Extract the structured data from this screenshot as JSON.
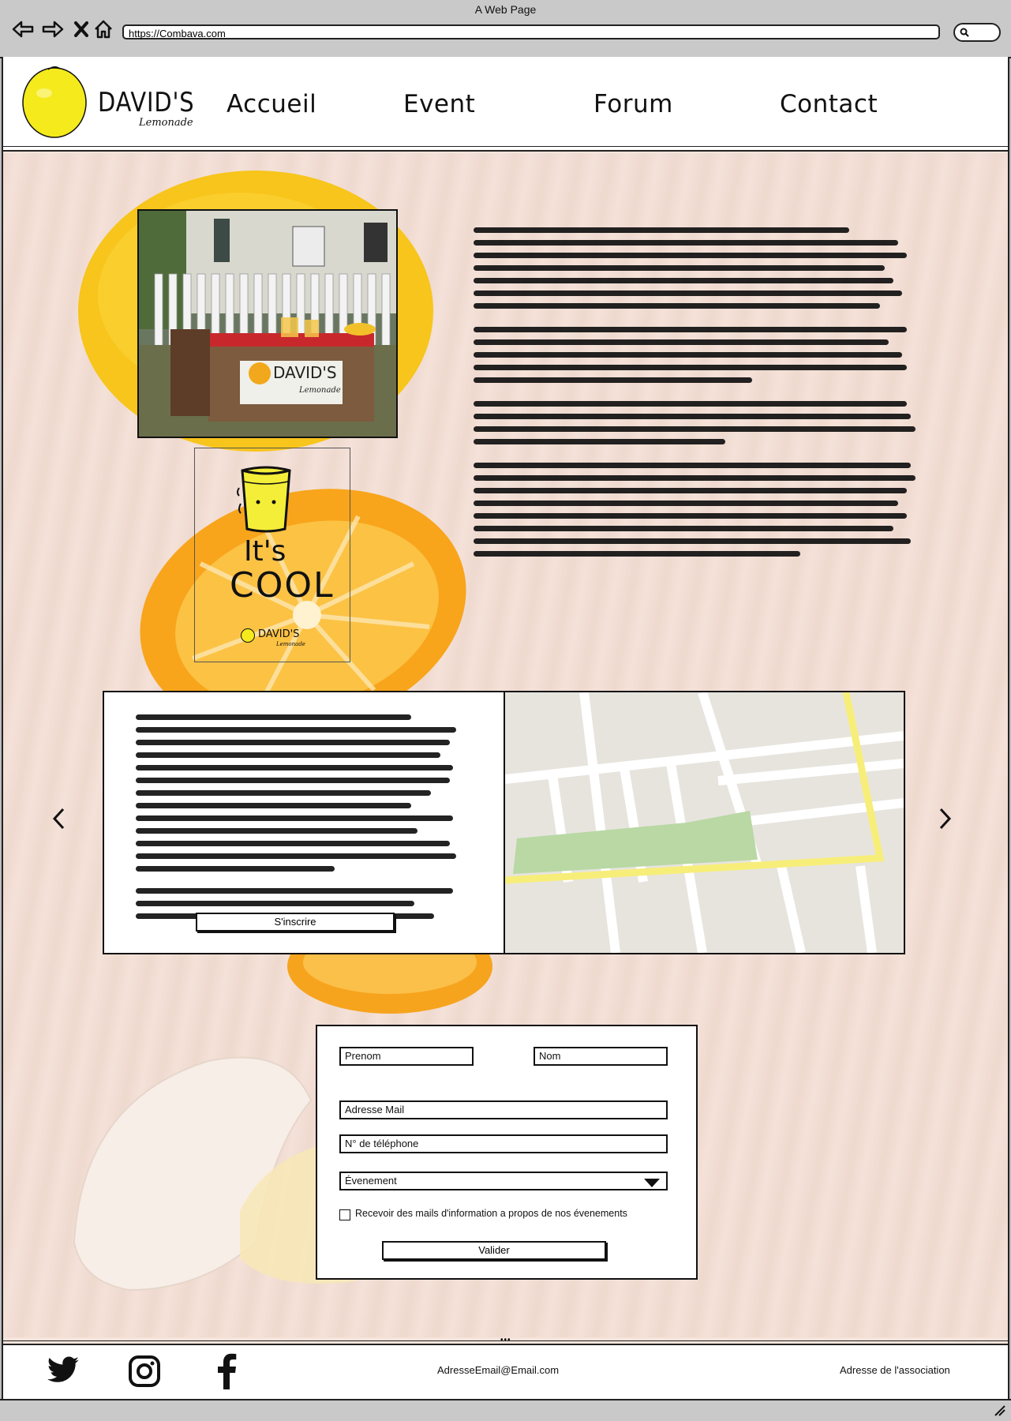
{
  "window": {
    "title": "A Web Page"
  },
  "browser": {
    "url": "https://Combava.com"
  },
  "brand": {
    "name_main": "DAVID'S",
    "name_sub": "Lemonade",
    "logo_color": "#f4ea1c"
  },
  "nav": {
    "items": [
      "Accueil",
      "Event",
      "Forum",
      "Contact"
    ]
  },
  "poster": {
    "line1": "It's",
    "line2": "COOL",
    "brand": "DAVID'S",
    "brand_sub": "Lemonade"
  },
  "stand_photo": {
    "sign_main": "DAVID'S",
    "sign_sub": "Lemonade"
  },
  "event_card": {
    "signup_label": "S'inscrire"
  },
  "form": {
    "prenom_placeholder": "Prenom",
    "nom_placeholder": "Nom",
    "email_placeholder": "Adresse Mail",
    "phone_placeholder": "N° de téléphone",
    "event_select_value": "Évenement",
    "newsletter_label": "Recevoir des mails d'information a propos de nos évenements",
    "submit_label": "Valider"
  },
  "footer": {
    "email": "AdresseEmail@Email.com",
    "address": "Adresse de l'association"
  },
  "colors": {
    "accent_yellow": "#f4ea1c",
    "map_road_yellow": "#f7ee7a",
    "map_park": "#b9d8a4"
  }
}
